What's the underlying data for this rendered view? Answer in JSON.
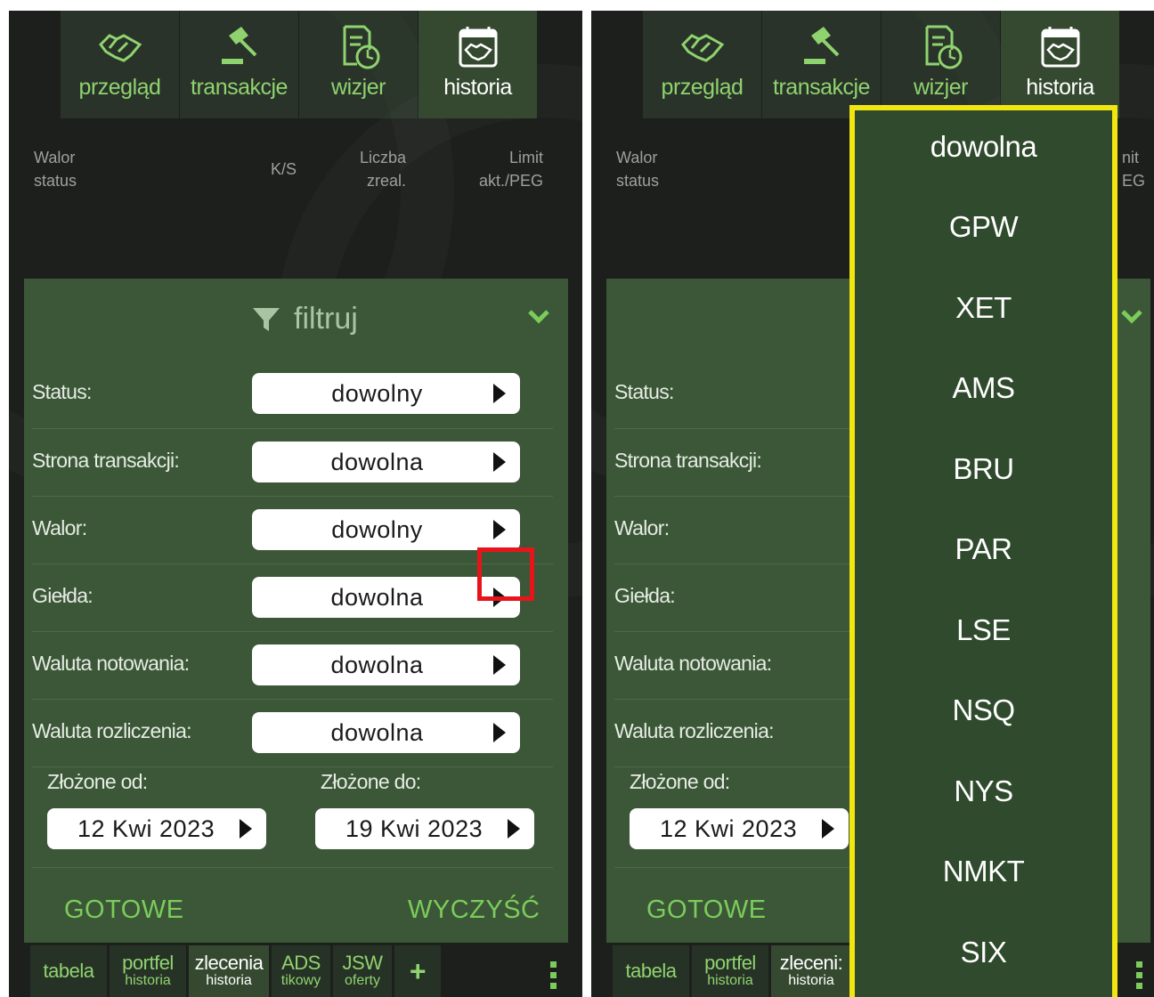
{
  "top_tabs": [
    {
      "label": "przegląd",
      "icon": "handshake-icon"
    },
    {
      "label": "transakcje",
      "icon": "gavel-icon"
    },
    {
      "label": "wizjer",
      "icon": "document-clock-icon"
    },
    {
      "label": "historia",
      "icon": "calendar-handshake-icon",
      "active": true
    }
  ],
  "columns": {
    "walor": "Walor",
    "status": "status",
    "ks": "K/S",
    "liczba": "Liczba",
    "zreal": "zreal.",
    "limit": "Limit",
    "akt_peg": "akt./PEG",
    "limit_cut": "nit",
    "peg_cut": "EG"
  },
  "filter": {
    "title": "filtruj",
    "rows": [
      {
        "label": "Status:",
        "value": "dowolny"
      },
      {
        "label": "Strona transakcji:",
        "value": "dowolna"
      },
      {
        "label": "Walor:",
        "value": "dowolny"
      },
      {
        "label": "Giełda:",
        "value": "dowolna"
      },
      {
        "label": "Waluta notowania:",
        "value": "dowolna"
      },
      {
        "label": "Waluta rozliczenia:",
        "value": "dowolna"
      }
    ],
    "from_label": "Złożone od:",
    "to_label": "Złożone do:",
    "from_date": "12 Kwi 2023",
    "to_date": "19 Kwi 2023",
    "done": "GOTOWE",
    "clear": "WYCZYŚĆ"
  },
  "bottom_tabs": [
    {
      "line1": "tabela",
      "line2": ""
    },
    {
      "line1": "portfel",
      "line2": "historia"
    },
    {
      "line1": "zlecenia",
      "line2": "historia",
      "active": true
    },
    {
      "line1": "ADS",
      "line2": "tikowy"
    },
    {
      "line1": "JSW",
      "line2": "oferty"
    },
    {
      "line1": "+",
      "line2": ""
    }
  ],
  "right_bottom": {
    "zlecenia_cut": "zleceni:",
    "historia": "historia"
  },
  "exchange_dropdown": {
    "options": [
      "dowolna",
      "GPW",
      "XET",
      "AMS",
      "BRU",
      "PAR",
      "LSE",
      "NSQ",
      "NYS",
      "NMKT",
      "SIX"
    ]
  },
  "colors": {
    "accent": "#7ccc5c",
    "panel": "#3b5737",
    "highlight_red": "#e8141c",
    "highlight_yellow": "#f2e611"
  }
}
